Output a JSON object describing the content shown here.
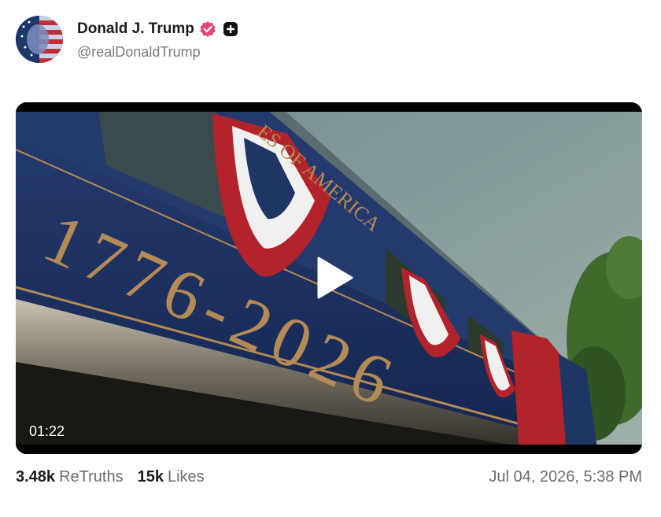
{
  "post": {
    "author": {
      "display_name": "Donald J. Trump",
      "handle": "@realDonaldTrump",
      "verified_icon": "verified-badge-icon",
      "extra_badge_icon": "plus-badge-icon"
    },
    "media": {
      "duration": "01:22",
      "play_icon": "play-icon",
      "train_number_text": "1776-2026",
      "car_lettering": "ES OF AMERICA"
    },
    "stats": {
      "retruths_count": "3.48k",
      "retruths_label": "ReTruths",
      "likes_count": "15k",
      "likes_label": "Likes"
    },
    "timestamp": "Jul 04, 2026, 5:38 PM"
  },
  "colors": {
    "verified_pink": "#e0457b",
    "train_blue": "#1f3566",
    "gold_lettering": "#b48a55",
    "muted_text": "#6b6b72"
  }
}
